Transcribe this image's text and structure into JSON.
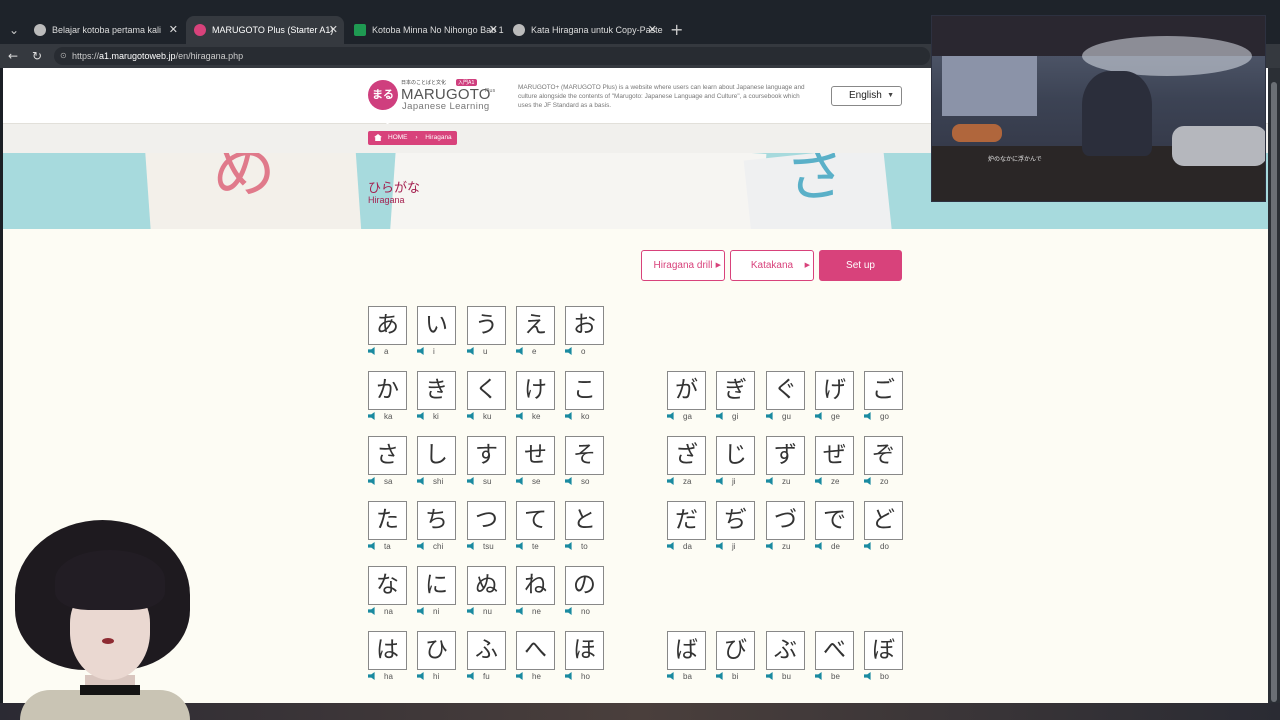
{
  "browser": {
    "tabs": [
      {
        "title": "Belajar kotoba pertama kali",
        "icon": "globe-icon"
      },
      {
        "title": "MARUGOTO Plus (Starter A1)",
        "icon": "marugoto-icon"
      },
      {
        "title": "Kotoba Minna No Nihongo Bab 1",
        "icon": "sheets-icon"
      },
      {
        "title": "Kata Hiragana untuk Copy-Paste",
        "icon": "globe-icon"
      }
    ],
    "active_tab": 1,
    "url_prefix": "https://",
    "url_host": "a1.marugotoweb.jp",
    "url_path": "/en/hiragana.php"
  },
  "site": {
    "logo_badge": "まるごと",
    "logo_small": "日本のことばと文化",
    "logo_a1": "入門A1",
    "logo_main": "MARUGOTO",
    "logo_plus": "Plus",
    "logo_sub": "Japanese Learning",
    "description": "MARUGOTO+ (MARUGOTO Plus) is a website where users can learn about Japanese language and culture alongside the contents of \"Marugoto: Japanese Language and Culture\", a coursebook which uses the JF Standard as a basis.",
    "language": "English",
    "accent_color": "#d8427b"
  },
  "breadcrumb": {
    "home": "HOME",
    "current": "Hiragana"
  },
  "banner": {
    "title": "ひらがな",
    "subtitle": "Hiragana"
  },
  "buttons": {
    "drill": "Hiragana drill",
    "katakana": "Katakana",
    "setup": "Set up"
  },
  "kana_rows": [
    {
      "basic": [
        [
          "あ",
          "a"
        ],
        [
          "い",
          "i"
        ],
        [
          "う",
          "u"
        ],
        [
          "え",
          "e"
        ],
        [
          "お",
          "o"
        ]
      ],
      "voiced": []
    },
    {
      "basic": [
        [
          "か",
          "ka"
        ],
        [
          "き",
          "ki"
        ],
        [
          "く",
          "ku"
        ],
        [
          "け",
          "ke"
        ],
        [
          "こ",
          "ko"
        ]
      ],
      "voiced": [
        [
          "が",
          "ga"
        ],
        [
          "ぎ",
          "gi"
        ],
        [
          "ぐ",
          "gu"
        ],
        [
          "げ",
          "ge"
        ],
        [
          "ご",
          "go"
        ]
      ]
    },
    {
      "basic": [
        [
          "さ",
          "sa"
        ],
        [
          "し",
          "shi"
        ],
        [
          "す",
          "su"
        ],
        [
          "せ",
          "se"
        ],
        [
          "そ",
          "so"
        ]
      ],
      "voiced": [
        [
          "ざ",
          "za"
        ],
        [
          "じ",
          "ji"
        ],
        [
          "ず",
          "zu"
        ],
        [
          "ぜ",
          "ze"
        ],
        [
          "ぞ",
          "zo"
        ]
      ]
    },
    {
      "basic": [
        [
          "た",
          "ta"
        ],
        [
          "ち",
          "chi"
        ],
        [
          "つ",
          "tsu"
        ],
        [
          "て",
          "te"
        ],
        [
          "と",
          "to"
        ]
      ],
      "voiced": [
        [
          "だ",
          "da"
        ],
        [
          "ぢ",
          "ji"
        ],
        [
          "づ",
          "zu"
        ],
        [
          "で",
          "de"
        ],
        [
          "ど",
          "do"
        ]
      ]
    },
    {
      "basic": [
        [
          "な",
          "na"
        ],
        [
          "に",
          "ni"
        ],
        [
          "ぬ",
          "nu"
        ],
        [
          "ね",
          "ne"
        ],
        [
          "の",
          "no"
        ]
      ],
      "voiced": []
    },
    {
      "basic": [
        [
          "は",
          "ha"
        ],
        [
          "ひ",
          "hi"
        ],
        [
          "ふ",
          "fu"
        ],
        [
          "へ",
          "he"
        ],
        [
          "ほ",
          "ho"
        ]
      ],
      "voiced": [
        [
          "ば",
          "ba"
        ],
        [
          "び",
          "bi"
        ],
        [
          "ぶ",
          "bu"
        ],
        [
          "べ",
          "be"
        ],
        [
          "ぼ",
          "bo"
        ]
      ]
    }
  ],
  "overlay": {
    "caption": "炉のなかに浮かんで"
  }
}
